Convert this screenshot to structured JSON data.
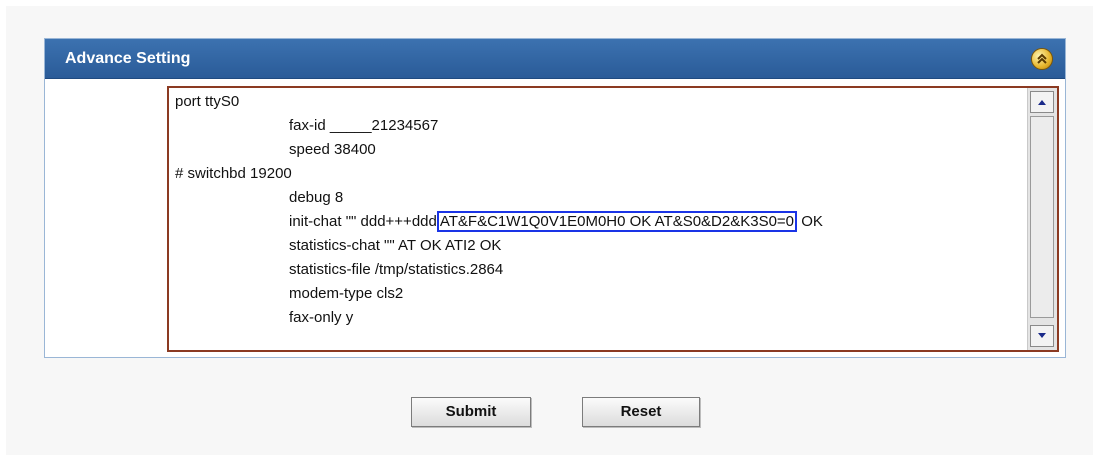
{
  "panel": {
    "title": "Advance Setting",
    "collapse_icon": "chevron-up-icon"
  },
  "config_editor": {
    "lines": [
      "port ttyS0",
      "fax-id _____21234567",
      "speed 38400",
      "# switchbd 19200",
      "debug 8",
      "statistics-chat \"\" AT OK ATI2 OK",
      "statistics-file /tmp/statistics.2864",
      "modem-type cls2",
      "fax-only y"
    ],
    "init_chat": {
      "prefix": "init-chat \"\" ddd+++ddd",
      "highlighted": "AT&F&C1W1Q0V1E0M0H0 OK AT&S0&D2&K3S0=0",
      "suffix": " OK"
    },
    "highlight_color": "#1a34e6",
    "border_color": "#8b3a22"
  },
  "scrollbar": {
    "up_icon": "arrow-up-icon",
    "down_icon": "arrow-down-icon"
  },
  "actions": {
    "submit_label": "Submit",
    "reset_label": "Reset"
  },
  "colors": {
    "header": "#2f64a4",
    "panel_border": "#9ab6d6"
  }
}
